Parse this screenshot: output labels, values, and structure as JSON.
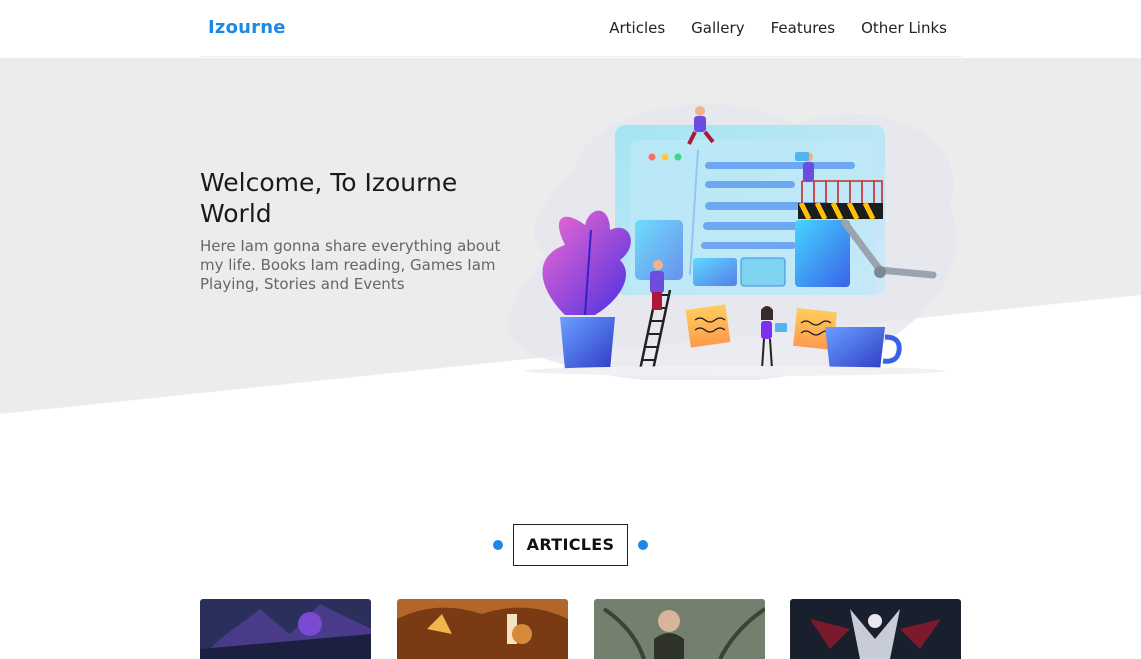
{
  "brand": "Izourne",
  "nav": {
    "links": [
      "Articles",
      "Gallery",
      "Features",
      "Other Links"
    ]
  },
  "hero": {
    "title": "Welcome, To Izourne World",
    "description": "Here Iam gonna share everything about my life. Books Iam reading, Games Iam Playing, Stories and Events"
  },
  "articles": {
    "heading": "ARTICLES"
  },
  "colors": {
    "accent": "#1e88e5",
    "hero_bg": "#ececec"
  }
}
